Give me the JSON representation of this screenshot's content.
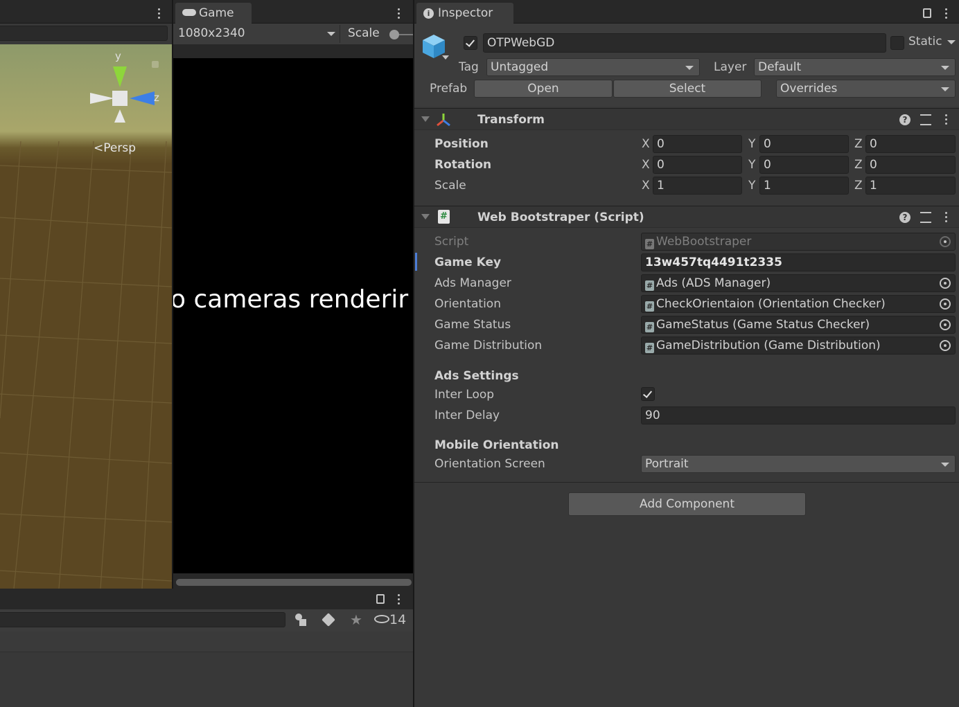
{
  "scene": {
    "gizmo_y": "y",
    "gizmo_z": "z",
    "projection_label": "Persp"
  },
  "game": {
    "tab_label": "Game",
    "resolution": "1080x2340",
    "scale_label": "Scale",
    "no_camera_text": "o cameras renderir"
  },
  "hierarchy": {
    "hidden_count": "14"
  },
  "inspector": {
    "tab_label": "Inspector",
    "object_name": "OTPWebGD",
    "object_active": true,
    "static_label": "Static",
    "tag_label": "Tag",
    "tag_value": "Untagged",
    "layer_label": "Layer",
    "layer_value": "Default",
    "prefab_label": "Prefab",
    "prefab_open": "Open",
    "prefab_select": "Select",
    "prefab_overrides": "Overrides",
    "transform": {
      "title": "Transform",
      "rows": [
        {
          "label": "Position",
          "x": "0",
          "y": "0",
          "z": "0"
        },
        {
          "label": "Rotation",
          "x": "0",
          "y": "0",
          "z": "0"
        },
        {
          "label": "Scale",
          "x": "1",
          "y": "1",
          "z": "1"
        }
      ],
      "axis_x": "X",
      "axis_y": "Y",
      "axis_z": "Z"
    },
    "script_component": {
      "title": "Web Bootstraper (Script)",
      "script_label": "Script",
      "script_value": "WebBootstraper",
      "game_key_label": "Game Key",
      "game_key_value": "13w457tq4491t2335",
      "ads_manager_label": "Ads Manager",
      "ads_manager_value": "Ads (ADS Manager)",
      "orientation_label": "Orientation",
      "orientation_value": "CheckOrientaion (Orientation Checker)",
      "game_status_label": "Game Status",
      "game_status_value": "GameStatus (Game Status Checker)",
      "game_distribution_label": "Game Distribution",
      "game_distribution_value": "GameDistribution (Game Distribution)",
      "ads_settings_header": "Ads Settings",
      "inter_loop_label": "Inter Loop",
      "inter_loop_value": true,
      "inter_delay_label": "Inter Delay",
      "inter_delay_value": "90",
      "mobile_orientation_header": "Mobile Orientation",
      "orientation_screen_label": "Orientation Screen",
      "orientation_screen_value": "Portrait"
    },
    "add_component": "Add Component"
  },
  "colors": {
    "scene_sky": "#9a9a5e",
    "scene_ground": "#5b4722",
    "accent_blue": "#4c7dd6",
    "gizmo_green": "#8ed63b",
    "gizmo_blue": "#3d7fe6"
  }
}
